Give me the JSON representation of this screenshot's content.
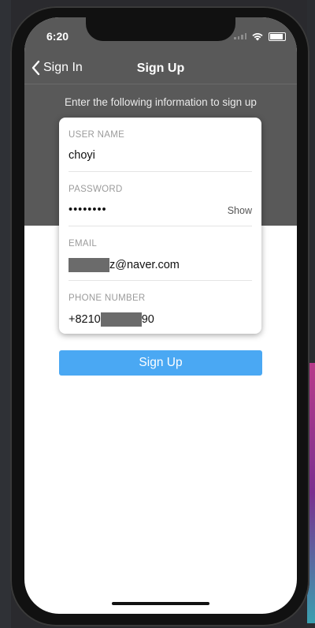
{
  "status_bar": {
    "time": "6:20"
  },
  "nav": {
    "back_label": "Sign In",
    "title": "Sign Up"
  },
  "form": {
    "subtitle": "Enter the following information to sign up",
    "fields": [
      {
        "label": "USER NAME",
        "value": "choyi"
      },
      {
        "label": "PASSWORD",
        "value": "••••••••",
        "show_label": "Show"
      },
      {
        "label": "EMAIL",
        "value": "z@naver.com"
      },
      {
        "label": "PHONE NUMBER",
        "value_prefix": "+8210",
        "value_suffix": "90"
      }
    ]
  },
  "actions": {
    "signup_label": "Sign Up"
  },
  "colors": {
    "header_bg": "#595959",
    "button_bg": "#4aa8f3"
  }
}
